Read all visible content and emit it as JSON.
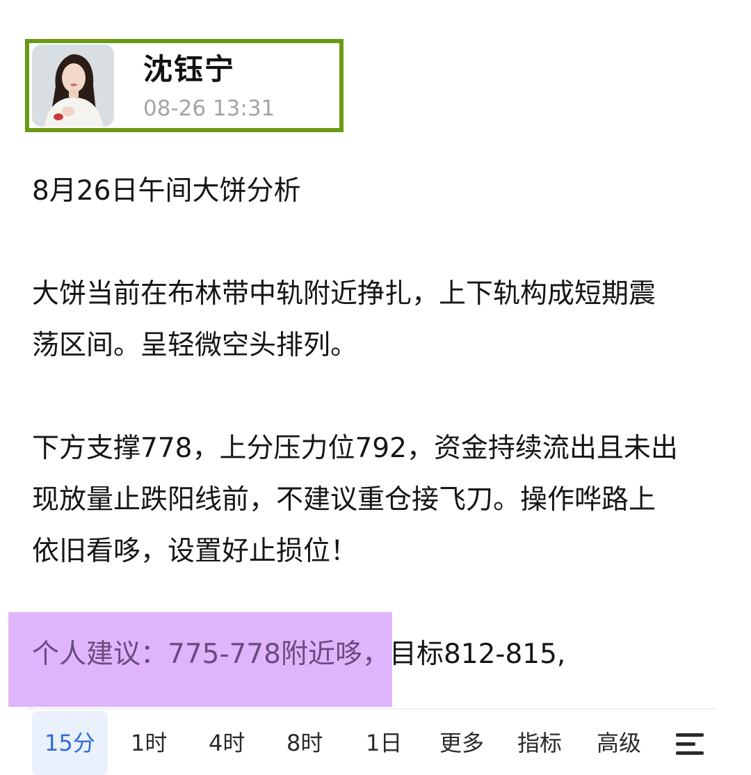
{
  "author": {
    "name": "沈钰宁",
    "time": "08-26 13:31"
  },
  "post": {
    "title": "8月26日午间大饼分析",
    "para1": [
      "大饼当前在布林带中轨附近挣扎，上下轨构成短期震",
      "荡区间。呈轻微空头排列。"
    ],
    "para2": [
      "下方支撑778，上分压力位792，资金持续流出且未出",
      "现放量止跌阳线前，不建议重仓接飞刀。操作哗路上",
      "依旧看哆，设置好止损位！"
    ],
    "suggestion_highlight": "个人建议：775-778附近哆，",
    "suggestion_rest": "目标812-815,"
  },
  "tabs": [
    {
      "label": "15分",
      "active": true
    },
    {
      "label": "1时"
    },
    {
      "label": "4时"
    },
    {
      "label": "8时"
    },
    {
      "label": "1日"
    },
    {
      "label": "更多"
    },
    {
      "label": "指标"
    },
    {
      "label": "高级"
    }
  ],
  "icons": {
    "tab_menu": "menu-lines-icon"
  },
  "colors": {
    "frame_green": "#6a9a14",
    "highlight_purple": "#e0b4fb",
    "active_tab_blue": "#2f6bd8",
    "time_gray": "#a4a4a4"
  }
}
